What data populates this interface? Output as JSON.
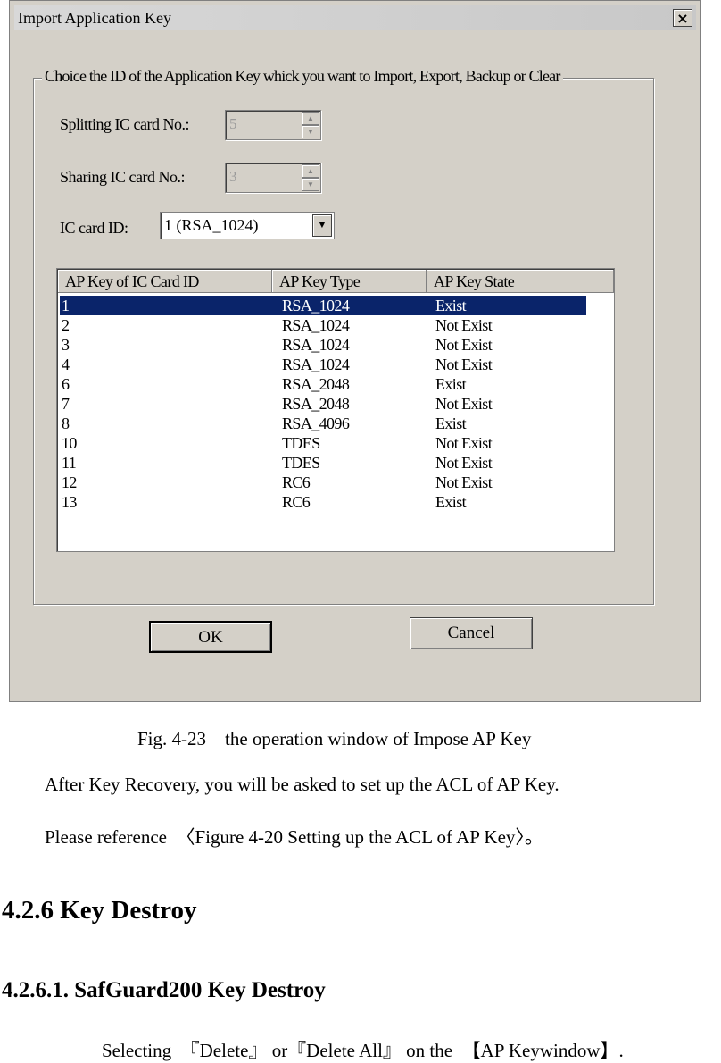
{
  "dialog": {
    "title": "Import Application Key",
    "close_label": "×",
    "group_label": "Choice the ID of the Application Key whick you want to Import, Export, Backup or Clear",
    "splitting_label": "Splitting IC card No.:",
    "splitting_value": "5",
    "sharing_label": "Sharing IC card No.:",
    "sharing_value": "3",
    "card_id_label": "IC card ID:",
    "card_id_value": "1 (RSA_1024)",
    "list": {
      "columns": [
        "AP Key of IC Card ID",
        "AP Key Type",
        "AP Key State"
      ],
      "rows": [
        {
          "id": "1",
          "type": "RSA_1024",
          "state": "Exist"
        },
        {
          "id": "2",
          "type": "RSA_1024",
          "state": "Not Exist"
        },
        {
          "id": "3",
          "type": "RSA_1024",
          "state": "Not Exist"
        },
        {
          "id": "4",
          "type": "RSA_1024",
          "state": "Not Exist"
        },
        {
          "id": "6",
          "type": "RSA_2048",
          "state": "Exist"
        },
        {
          "id": "7",
          "type": "RSA_2048",
          "state": "Not Exist"
        },
        {
          "id": "8",
          "type": "RSA_4096",
          "state": "Exist"
        },
        {
          "id": "10",
          "type": "TDES",
          "state": "Not Exist"
        },
        {
          "id": "11",
          "type": "TDES",
          "state": "Not Exist"
        },
        {
          "id": "12",
          "type": "RC6",
          "state": "Not Exist"
        },
        {
          "id": "13",
          "type": "RC6",
          "state": "Exist"
        }
      ]
    },
    "ok_label": "OK",
    "cancel_label": "Cancel"
  },
  "document": {
    "caption": "Fig. 4-23　the  operation window of Impose AP Key",
    "para1": "After Key Recovery, you will be asked to set up the ACL of AP Key.",
    "para2": "Please reference　〈Figure 4-20 Setting up the ACL of AP Key〉。",
    "heading_section": "4.2.6 Key Destroy",
    "heading_subsection": "4.2.6.1.  SafGuard200 Key Destroy",
    "para3": "Selecting　『Delete』 or『Delete All』  on  the　【AP Keywindow】."
  }
}
